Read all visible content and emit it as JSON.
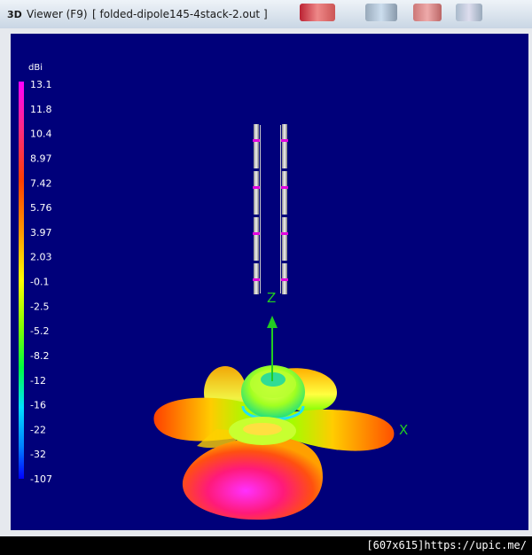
{
  "window": {
    "icon_label": "3D",
    "title": "Viewer (F9)",
    "file": "[  folded-dipole145-4stack-2.out ]"
  },
  "colors": {
    "background": "#00007a",
    "axis": "#22cc22"
  },
  "legend": {
    "unit": "dBi",
    "ticks": [
      "13.1",
      "11.8",
      "10.4",
      "8.97",
      "7.42",
      "5.76",
      "3.97",
      "2.03",
      "-0.1",
      "-2.5",
      "-5.2",
      "-8.2",
      "-12",
      "-16",
      "-22",
      "-32",
      "-107"
    ]
  },
  "axes": {
    "z_label": "Z",
    "x_label": "X"
  },
  "footer": {
    "text": "[607x615]https://upic.me/"
  }
}
